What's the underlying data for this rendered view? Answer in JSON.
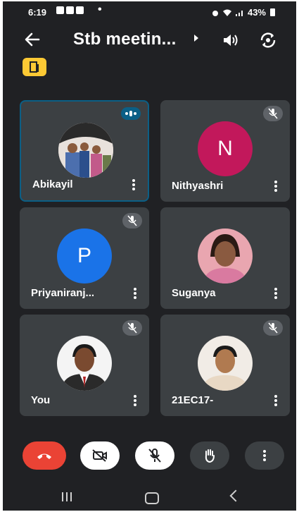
{
  "status_bar": {
    "time": "6:19",
    "dot": "•",
    "battery": "43%"
  },
  "app_bar": {
    "title": "Stb meetin..."
  },
  "participants": [
    {
      "name": "Abikayil",
      "state": "speaking",
      "avatar": "photo-group"
    },
    {
      "name": "Nithyashri",
      "state": "muted",
      "avatar_letter": "N",
      "avatar_color": "#c2185b"
    },
    {
      "name": "Priyaniranj...",
      "state": "muted",
      "avatar_letter": "P",
      "avatar_color": "#1a73e8"
    },
    {
      "name": "Suganya",
      "state": "unmuted",
      "avatar": "photo-person"
    },
    {
      "name": "You",
      "state": "muted",
      "avatar": "photo-person"
    },
    {
      "name": "21EC17-",
      "state": "muted",
      "avatar": "photo-person"
    }
  ],
  "controls": [
    "end-call",
    "camera-off",
    "mic-off",
    "raise-hand",
    "more-options"
  ],
  "colors": {
    "background": "#202124",
    "tile": "#3c4043",
    "end_call": "#ea4335",
    "speaking": "#0b5f86",
    "badge": "#fcc934"
  }
}
